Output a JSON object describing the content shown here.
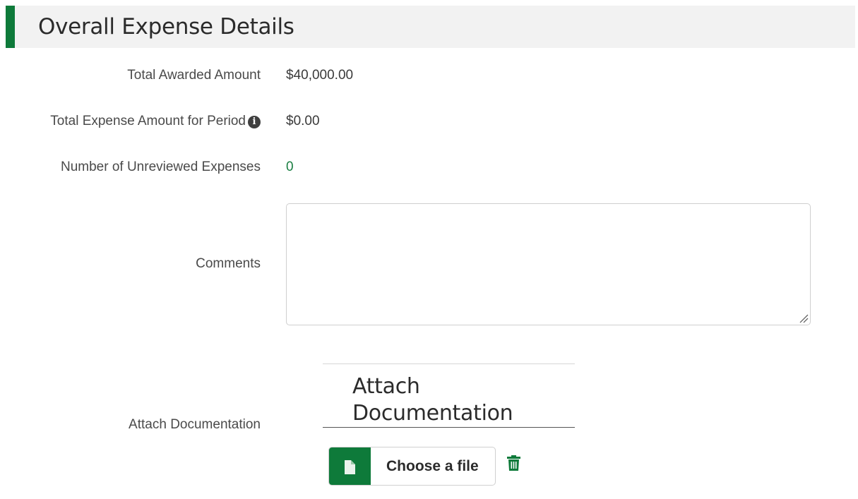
{
  "section": {
    "title": "Overall Expense Details"
  },
  "fields": {
    "total_awarded": {
      "label": "Total Awarded Amount",
      "value": "$40,000.00"
    },
    "total_expense": {
      "label": "Total Expense Amount for Period",
      "value": "$0.00",
      "info_icon": "info-circle-icon"
    },
    "unreviewed": {
      "label": "Number of Unreviewed Expenses",
      "value": "0"
    },
    "comments": {
      "label": "Comments",
      "value": "",
      "placeholder": ""
    },
    "attach": {
      "label": "Attach Documentation",
      "panel_title": "Attach Documentation",
      "choose_label": "Choose a file",
      "file_icon": "file-icon",
      "delete_icon": "trash-icon"
    }
  },
  "colors": {
    "accent": "#0e7a3a",
    "header_bg": "#f2f2f2",
    "count_value": "#1b7f43"
  }
}
